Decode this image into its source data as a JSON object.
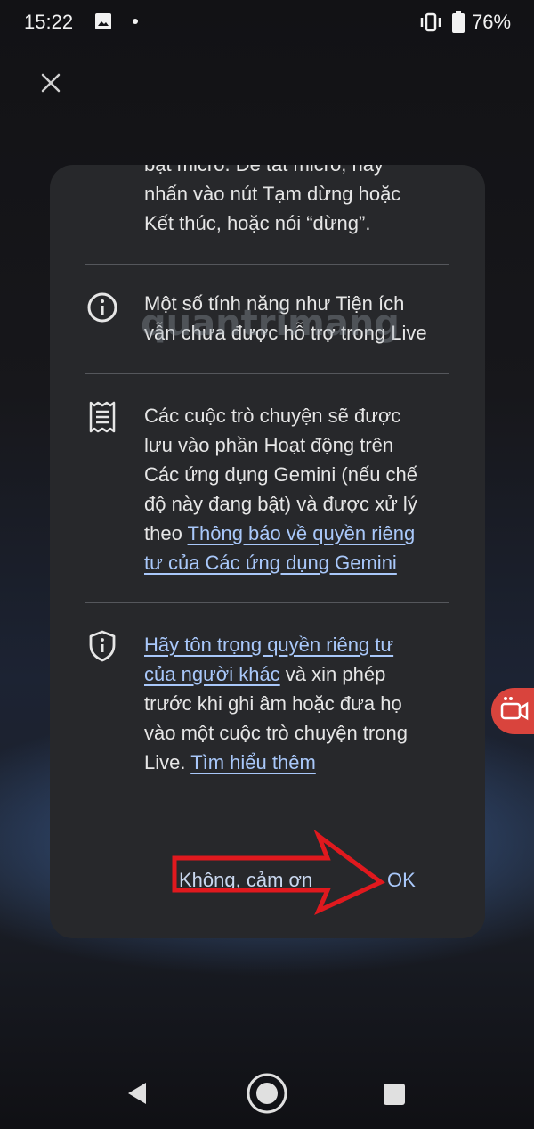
{
  "status_bar": {
    "time": "15:22",
    "battery_percent": "76%",
    "icons": [
      "image-icon",
      "notification-dot",
      "vibrate-icon",
      "battery-icon"
    ]
  },
  "dialog": {
    "item_mic": {
      "line_1": "bật micrô. Để tắt micrô, hãy",
      "line_2": "nhấn vào nút Tạm dừng hoặc",
      "line_3": "Kết thúc, hoặc nói “dừng”."
    },
    "item_features": {
      "icon": "info-icon",
      "line_1": "Một số tính năng như Tiện ích",
      "line_2": "vẫn chưa được hỗ trợ trong Live"
    },
    "item_activity": {
      "icon": "receipt-icon",
      "line_1": "Các cuộc trò chuyện sẽ được",
      "line_2": "lưu vào phần Hoạt động trên",
      "line_3": "Các ứng dụng Gemini (nếu chế",
      "line_4": "độ này đang bật) và được xử lý",
      "line_5_prefix": "theo ",
      "line_5_link": "Thông báo về quyền riêng",
      "line_6_link": "tư của Các ứng dụng Gemini"
    },
    "item_privacy": {
      "icon": "shield-icon",
      "line_1_link": "Hãy tôn trọng quyền riêng tư",
      "line_2_link": "của người khác",
      "line_2_rest": " và xin phép",
      "line_3": "trước khi ghi âm hoặc đưa họ",
      "line_4": "vào một cuộc trò chuyện trong",
      "line_5_prefix": "Live. ",
      "line_5_link": "Tìm hiểu thêm"
    },
    "cancel_label": "Không, cảm ơn",
    "ok_label": "OK"
  },
  "watermark": "quantrimang",
  "colors": {
    "dialog_bg": "#27282b",
    "link": "#a9c8fa",
    "annotation_arrow": "#e0191e",
    "side_button": "#d9443d"
  },
  "nav": {
    "icons": [
      "back-icon",
      "home-icon",
      "recents-icon"
    ]
  }
}
